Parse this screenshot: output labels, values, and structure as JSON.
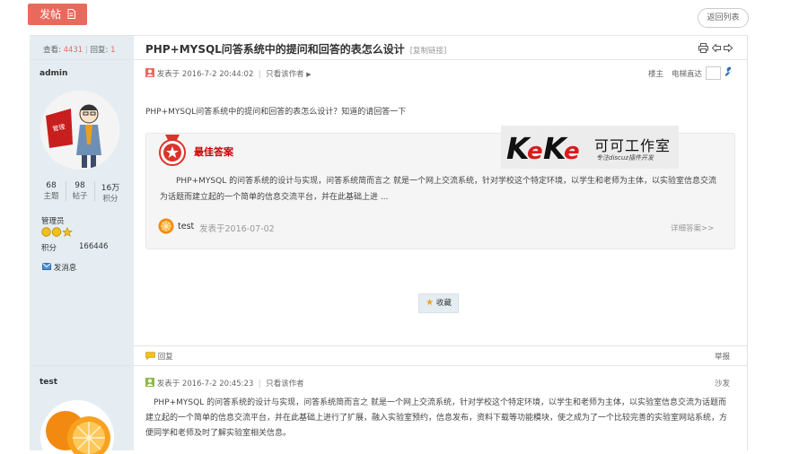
{
  "toolbar": {
    "post_label": "发帖",
    "back_label": "返回列表"
  },
  "thread": {
    "views_label": "查看:",
    "views": "4431",
    "replies_label": "回复:",
    "replies": "1",
    "title": "PHP+MYSQL问答系统中的提问和回答的表怎么设计",
    "copy_link": "[复制链接]"
  },
  "post1": {
    "author": "admin",
    "stats": [
      {
        "value": "68",
        "label": "主题"
      },
      {
        "value": "98",
        "label": "帖子"
      },
      {
        "value": "16万",
        "label": "积分"
      }
    ],
    "group": "管理员",
    "credits_label": "积分",
    "credits": "166446",
    "send_msg": "发消息",
    "posted_at": "发表于 2016-7-2 20:44:02",
    "only_author": "只看该作者",
    "floor": "楼主",
    "goto_label": "电梯直达",
    "content": "PHP+MYSQL问答系统中的提问和回答的表怎么设计？知道的请回答一下",
    "best_answer": {
      "title": "最佳答案",
      "text": "PHP+MYSQL 的问答系统的设计与实现，问答系统简而言之 就是一个网上交流系统，针对学校这个特定环境，以学生和老师为主体，以实验室信息交流为话题而建立起的一个简单的信息交流平台，并在此基础上进 ...",
      "user": "test",
      "posted_at": "发表于2016-07-02",
      "detail_link": "详细答案>>"
    },
    "watermark_brand": "KeKe",
    "watermark_title": "可可工作室",
    "watermark_sub": "专注discuz插件开发",
    "favorite": "收藏",
    "reply": "回复",
    "report": "举报"
  },
  "post2": {
    "author": "test",
    "posted_at": "发表于 2016-7-2 20:45:23",
    "only_author": "只看该作者",
    "floor": "沙发",
    "content": "PHP+MYSQL 的问答系统的设计与实现，问答系统简而言之 就是一个网上交流系统，针对学校这个特定环境，以学生和老师为主体，以实验室信息交流为话题而建立起的一个简单的信息交流平台，并在此基础上进行了扩展，融入实验室预约，信息发布，资料下载等功能模块，使之成为了一个比较完善的实验室网站系统，方便同学和老师及时了解实验室相关信息。"
  },
  "colors": {
    "post_button": "#e96a5d",
    "sidebar": "#e5edf2",
    "best_title": "#cc0000",
    "stars": "#f0c020"
  }
}
